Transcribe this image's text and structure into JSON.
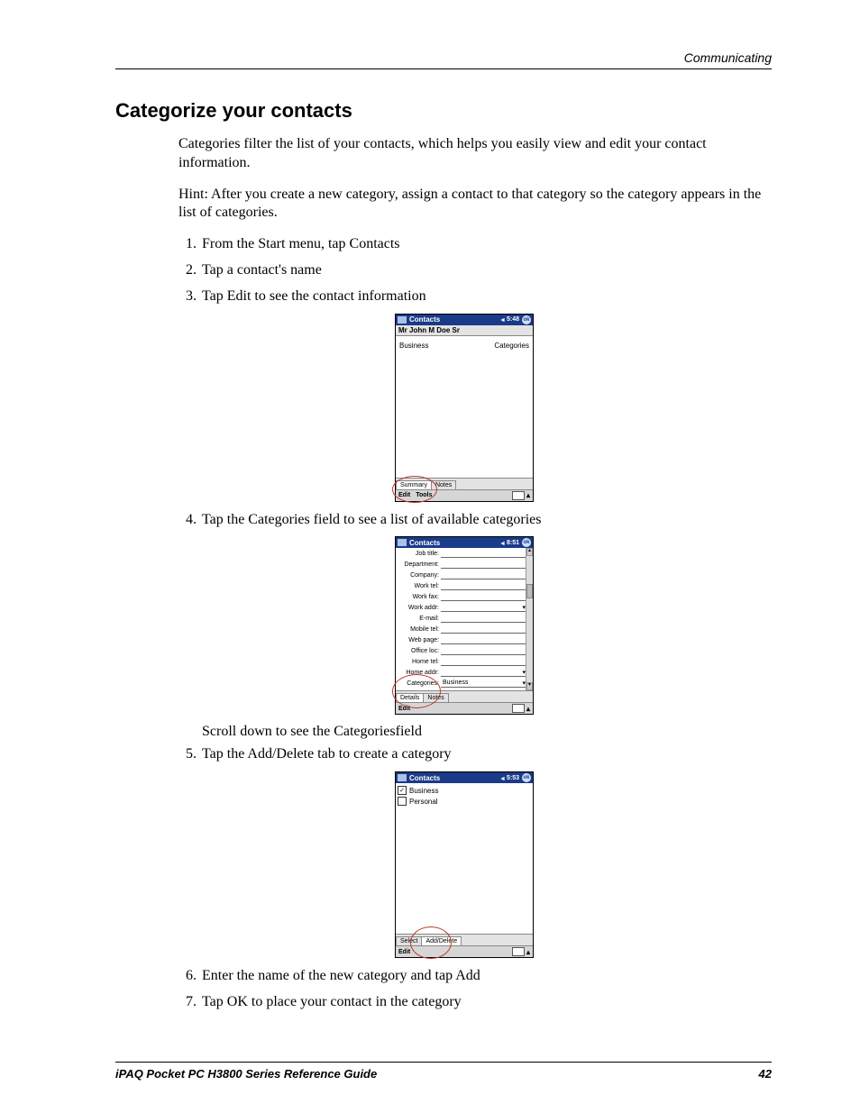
{
  "header": {
    "running_head": "Communicating"
  },
  "footer": {
    "left": "iPAQ Pocket PC H3800 Series Reference Guide",
    "page": "42"
  },
  "title": "Categorize your contacts",
  "paras": {
    "intro": "Categories filter the list of your contacts, which helps you easily view and edit your contact information.",
    "hint": "Hint: After you create a new category, assign a contact to that category so the category appears in the list of categories."
  },
  "steps": {
    "s1": "From the Start menu, tap Contacts",
    "s2": "Tap a contact's name",
    "s3": "Tap Edit to see the contact information",
    "s4": "Tap the Categories field to see a list of available categories",
    "s4_sub": "Scroll down to see the Categoriesfield",
    "s5": "Tap the Add/Delete tab to create a category",
    "s6": "Enter the name of the new category and tap Add",
    "s7": "Tap OK to place your contact in the category"
  },
  "shot1": {
    "title": "Contacts",
    "time": "5:48",
    "ok": "ok",
    "name": "Mr John M Doe Sr",
    "left": "Business",
    "right": "Categories",
    "tab_summary": "Summary",
    "tab_notes": "Notes",
    "menu_edit": "Edit",
    "menu_tools": "Tools"
  },
  "shot2": {
    "title": "Contacts",
    "time": "8:51",
    "ok": "ok",
    "fields": {
      "job": "Job title:",
      "dept": "Department:",
      "company": "Company:",
      "worktel": "Work tel:",
      "workfax": "Work fax:",
      "workaddr": "Work addr:",
      "email": "E-mail:",
      "mobile": "Mobile tel:",
      "web": "Web page:",
      "office": "Office loc:",
      "hometel": "Home tel:",
      "homeaddr": "Home addr:",
      "categories": "Categories:"
    },
    "cat_value": "Business",
    "tab_details": "Details",
    "tab_notes": "Notes",
    "menu_edit": "Edit"
  },
  "shot3": {
    "title": "Contacts",
    "time": "5:53",
    "ok": "ok",
    "check_business": "Business",
    "check_personal": "Personal",
    "check_mark": "✓",
    "tab_select": "Select",
    "tab_adddel": "Add/Delete",
    "menu_edit": "Edit"
  }
}
